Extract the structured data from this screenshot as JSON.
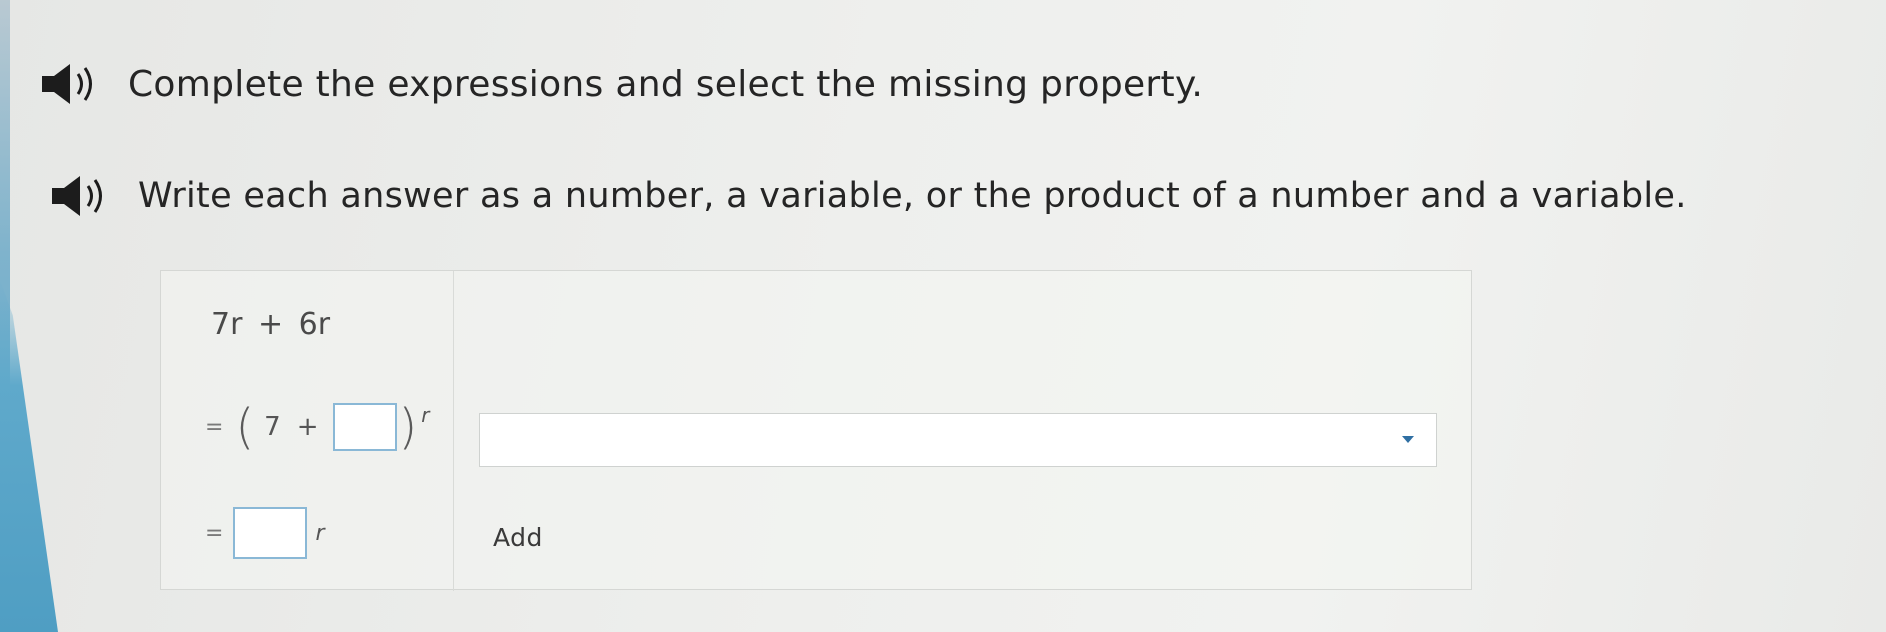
{
  "instructions": [
    {
      "text": "Complete the expressions and select the missing property."
    },
    {
      "text": "Write each answer as a number, a variable, or the product of a number and a variable."
    }
  ],
  "problem": {
    "expression": "7r + 6r",
    "step1": {
      "equals": "=",
      "first_term": "7",
      "operator": "+",
      "answer": "",
      "variable": "r"
    },
    "step2": {
      "equals": "=",
      "answer": "",
      "variable": "r"
    },
    "property_select": {
      "selected": ""
    },
    "property_label": "Add"
  },
  "icons": [
    "speaker-icon",
    "chevron-down-icon"
  ],
  "colors": {
    "answer_border": "#8ab8d6",
    "chevron": "#2f6fa3",
    "speaker": "#1c1c1c",
    "side_accent": "#5aa5c8"
  }
}
